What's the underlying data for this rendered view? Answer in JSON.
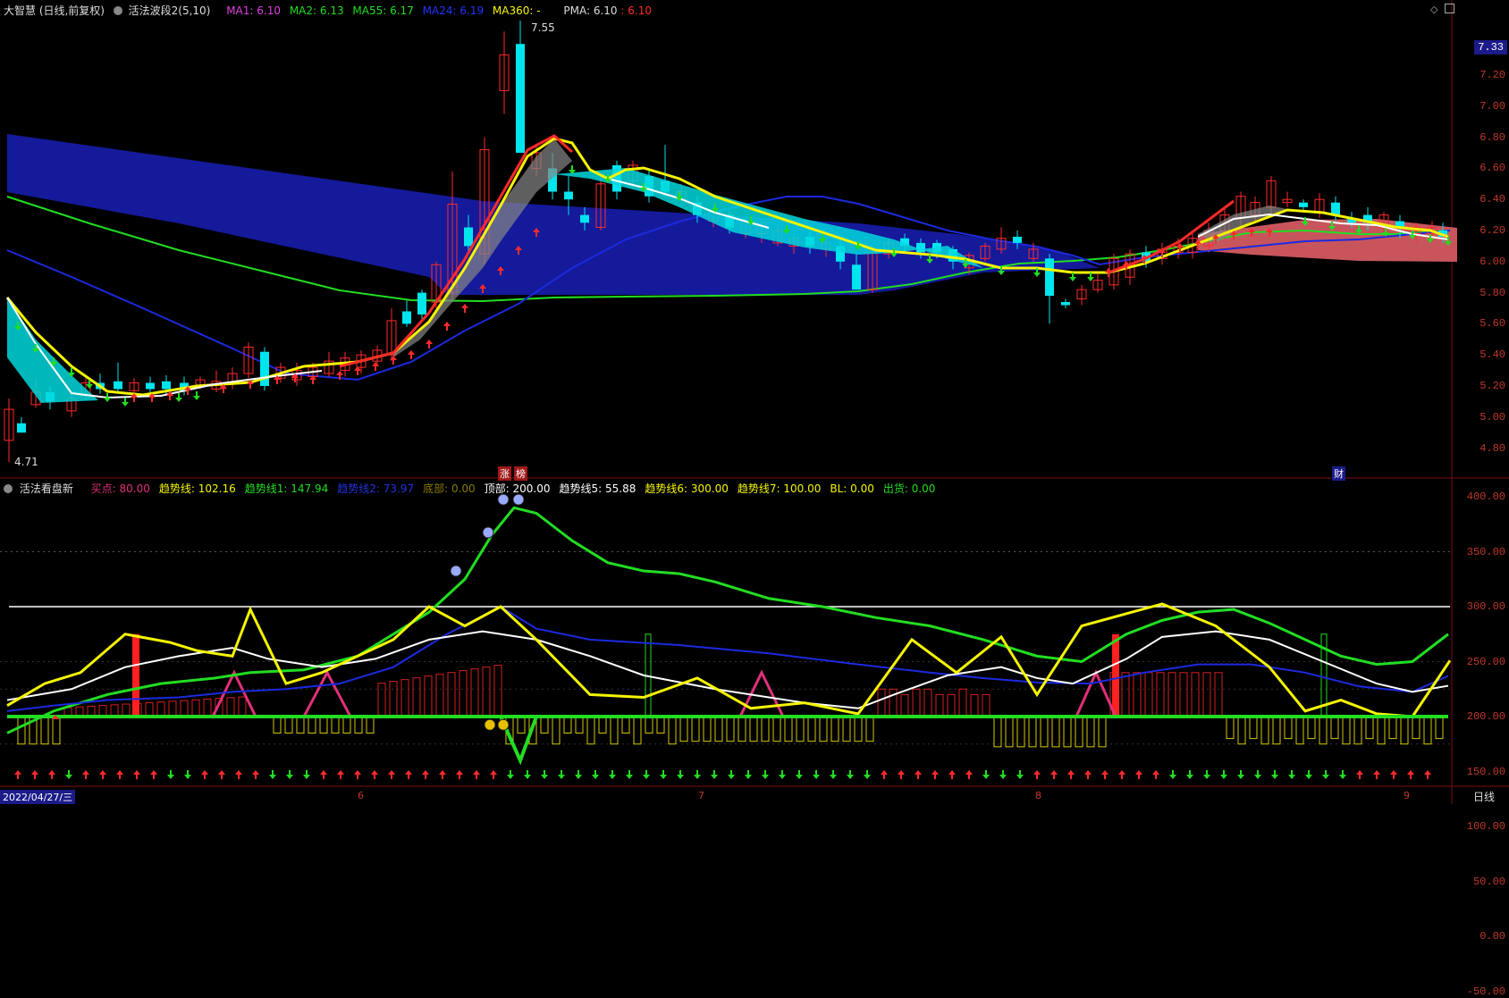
{
  "header_main": {
    "title": "大智慧 (日线,前复权)",
    "indicator_name": "活法波段2(5,10)",
    "ma1": "MA1: 6.10",
    "ma2": "MA2: 6.13",
    "ma55": "MA55: 6.17",
    "ma24": "MA24: 6.19",
    "ma360": "MA360: -",
    "pma": "PMA: 6.10",
    "pma_val": ": 6.10"
  },
  "header_sub": {
    "name": "活法看盘新",
    "items": [
      {
        "text": "买点: 80.00",
        "color": "#e0307a"
      },
      {
        "text": "趋势线: 102.16",
        "color": "#f5f500"
      },
      {
        "text": "趋势线1: 147.94",
        "color": "#22dd22"
      },
      {
        "text": "趋势线2: 73.97",
        "color": "#2233dd"
      },
      {
        "text": "底部: 0.00",
        "color": "#8a7a00"
      },
      {
        "text": "顶部: 200.00",
        "color": "#ffffff"
      },
      {
        "text": "趋势线5: 55.88",
        "color": "#ffffff"
      },
      {
        "text": "趋势线6: 300.00",
        "color": "#f5f500"
      },
      {
        "text": "趋势线7: 100.00",
        "color": "#f5f500"
      },
      {
        "text": "BL: 0.00",
        "color": "#f5f500"
      },
      {
        "text": "出货: 0.00",
        "color": "#22dd22"
      }
    ]
  },
  "price_axis": [
    "7.20",
    "7.00",
    "6.80",
    "6.60",
    "6.40",
    "6.20",
    "6.00",
    "5.80",
    "5.60",
    "5.40",
    "5.20",
    "5.00",
    "4.80"
  ],
  "current_price": "7.33",
  "ind_axis": [
    "400.00",
    "350.00",
    "300.00",
    "250.00",
    "200.00",
    "150.00",
    "100.00",
    "50.00",
    "0.00",
    "-50.00"
  ],
  "annotations": {
    "high": "7.55",
    "low": "4.71",
    "tag_up": "涨",
    "tag_hot": "榜",
    "tag_cai": "财"
  },
  "time_axis": {
    "date": "2022/04/27/三",
    "months": [
      "6",
      "7",
      "8",
      "9"
    ],
    "period": "日线"
  },
  "colors": {
    "up": "#ff2a2a",
    "down": "#00e5ee",
    "ma_green": "#22dd22",
    "ma_blue": "#1c2adf",
    "ma_yellow": "#f5f500",
    "ma_white": "#ffffff",
    "cloud": "#141a9a"
  }
}
